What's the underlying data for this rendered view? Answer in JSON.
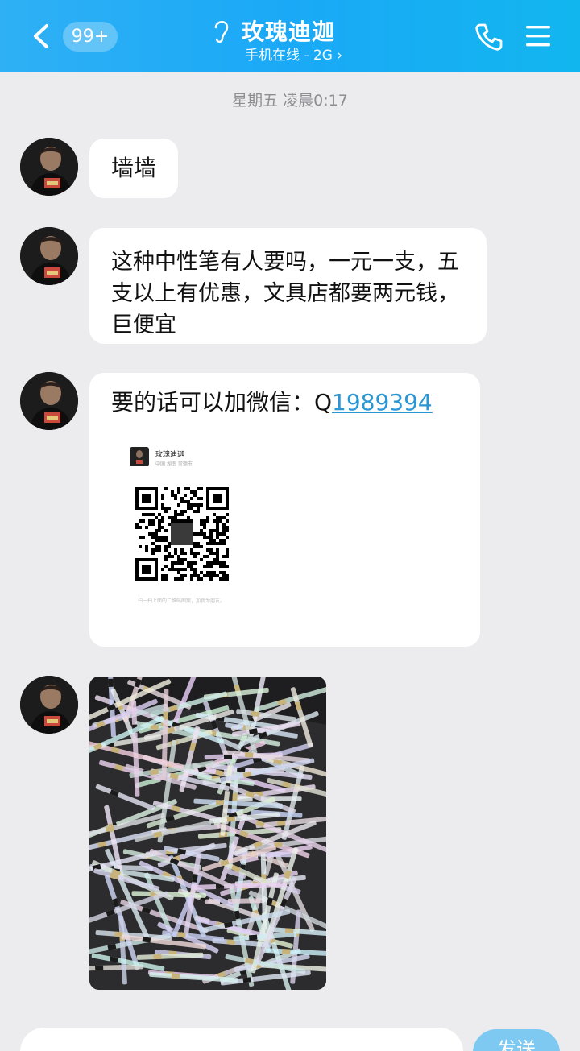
{
  "header": {
    "unread_badge": "99+",
    "contact_name": "玫瑰迪迦",
    "status": "手机在线 - 2G ›"
  },
  "timestamp": "星期五 凌晨0:17",
  "messages": [
    {
      "text": "墙墙"
    },
    {
      "text": "这种中性笔有人要吗，一元一支，五支以上有优惠，文具店都要两元钱，巨便宜"
    },
    {
      "text_prefix": "要的话可以加微信：Q",
      "qq_link": "1989394",
      "qr_card": {
        "name": "玫瑰迪迦",
        "subtitle": "中国 湖南 常德市",
        "footer": "扫一扫上面的二维码图案，加我为朋友。"
      }
    },
    {
      "image": "pens-photo"
    }
  ],
  "input": {
    "send_label": "发送"
  },
  "colors": {
    "header": "#1aa9f6",
    "link": "#2a96d4",
    "background": "#ececef"
  }
}
